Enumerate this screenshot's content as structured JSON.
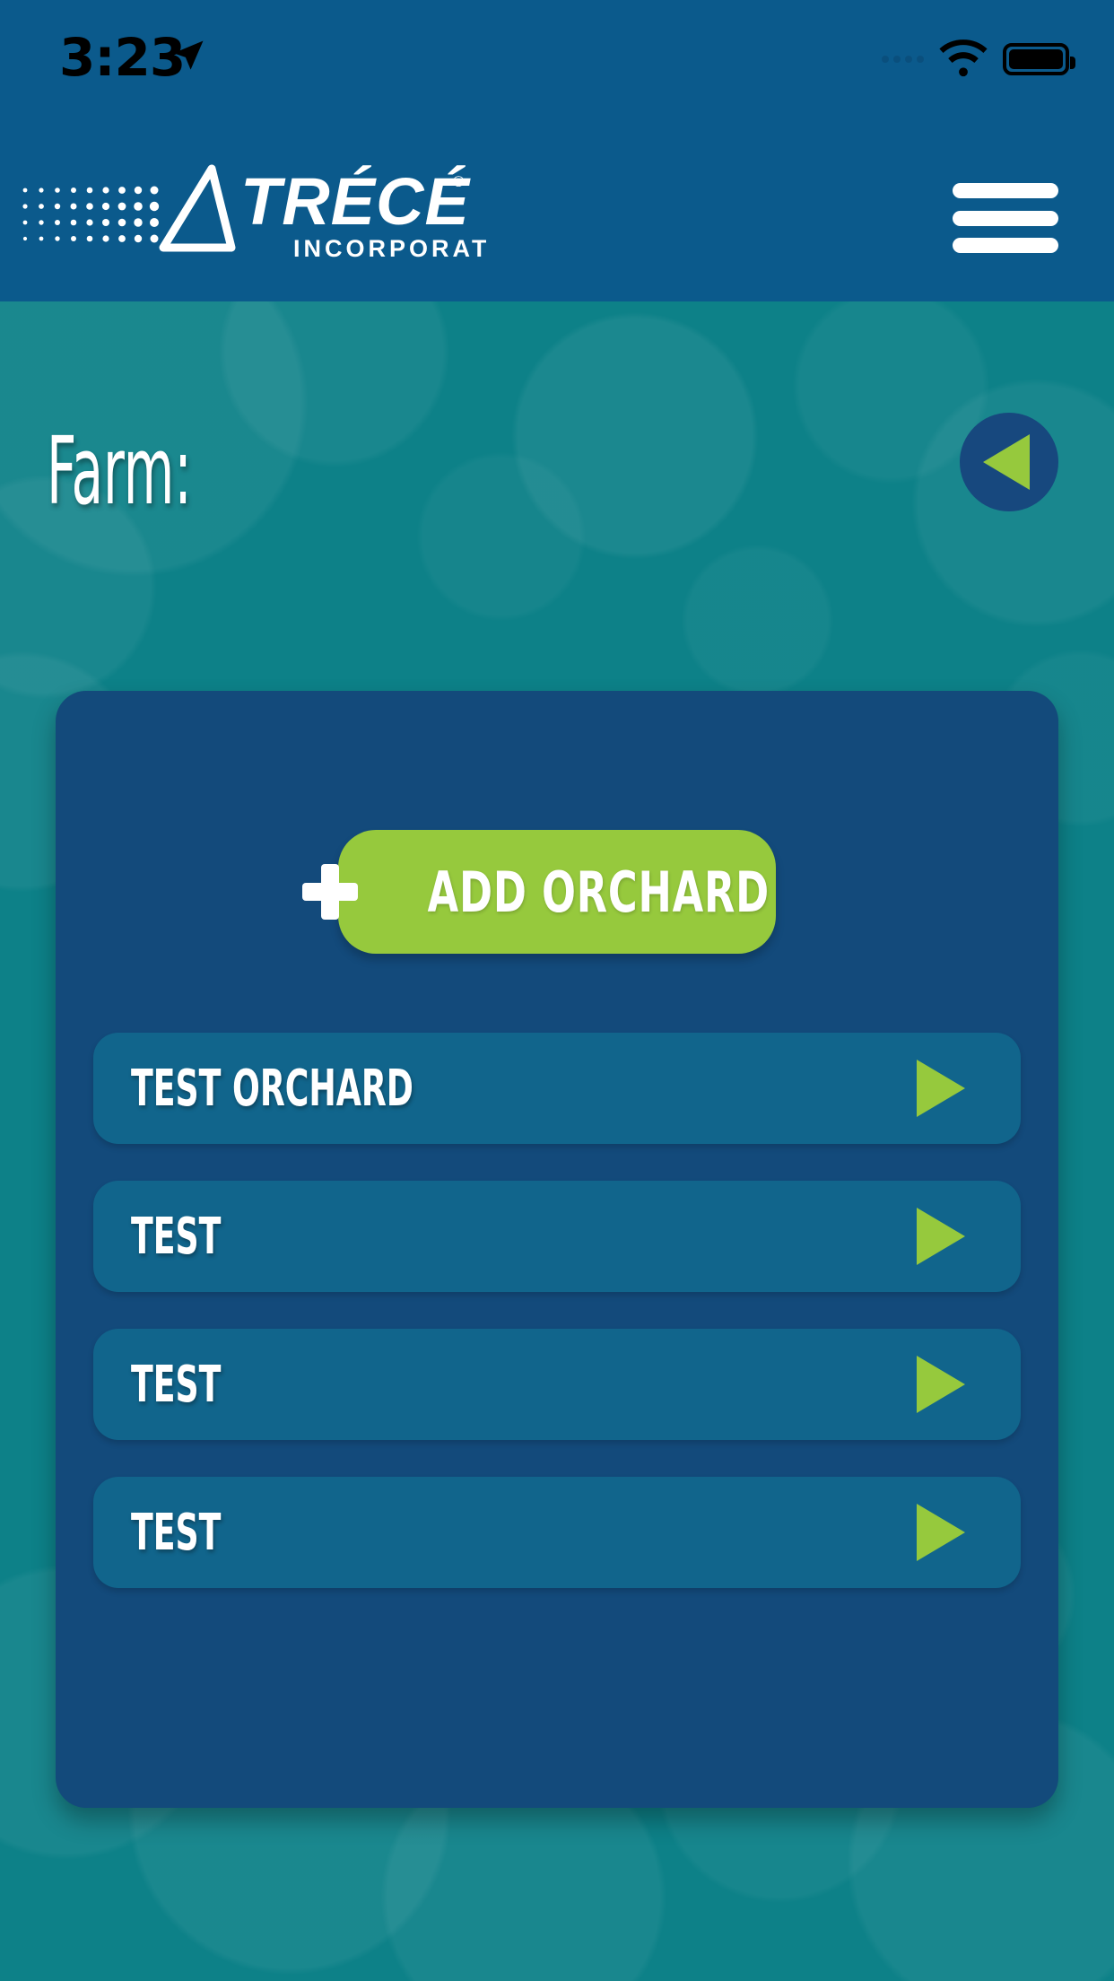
{
  "status_bar": {
    "time": "3:23",
    "location_icon": "location-arrow-icon",
    "signal_icon": "signal-dots-icon",
    "wifi_icon": "wifi-icon",
    "battery_icon": "battery-full-icon"
  },
  "header": {
    "logo_name": "TRÉCÉ",
    "logo_registered": "®",
    "logo_subtitle": "INCORPORATED",
    "menu_icon": "hamburger-menu-icon",
    "background_color": "#0b5a8c"
  },
  "page": {
    "title_label": "Farm:",
    "farm_name": "",
    "back_icon": "back-triangle-icon",
    "background_color": "#0d8188"
  },
  "card": {
    "background_color": "#134a7b",
    "add_button": {
      "label": "ADD ORCHARD",
      "icon": "plus-icon",
      "color": "#96c93d"
    },
    "orchards": [
      {
        "name": "TEST ORCHARD",
        "chevron_icon": "play-triangle-icon"
      },
      {
        "name": "TEST",
        "chevron_icon": "play-triangle-icon"
      },
      {
        "name": "TEST",
        "chevron_icon": "play-triangle-icon"
      },
      {
        "name": "TEST",
        "chevron_icon": "play-triangle-icon"
      }
    ],
    "row_color": "#11658c",
    "accent_color": "#96c93d"
  }
}
